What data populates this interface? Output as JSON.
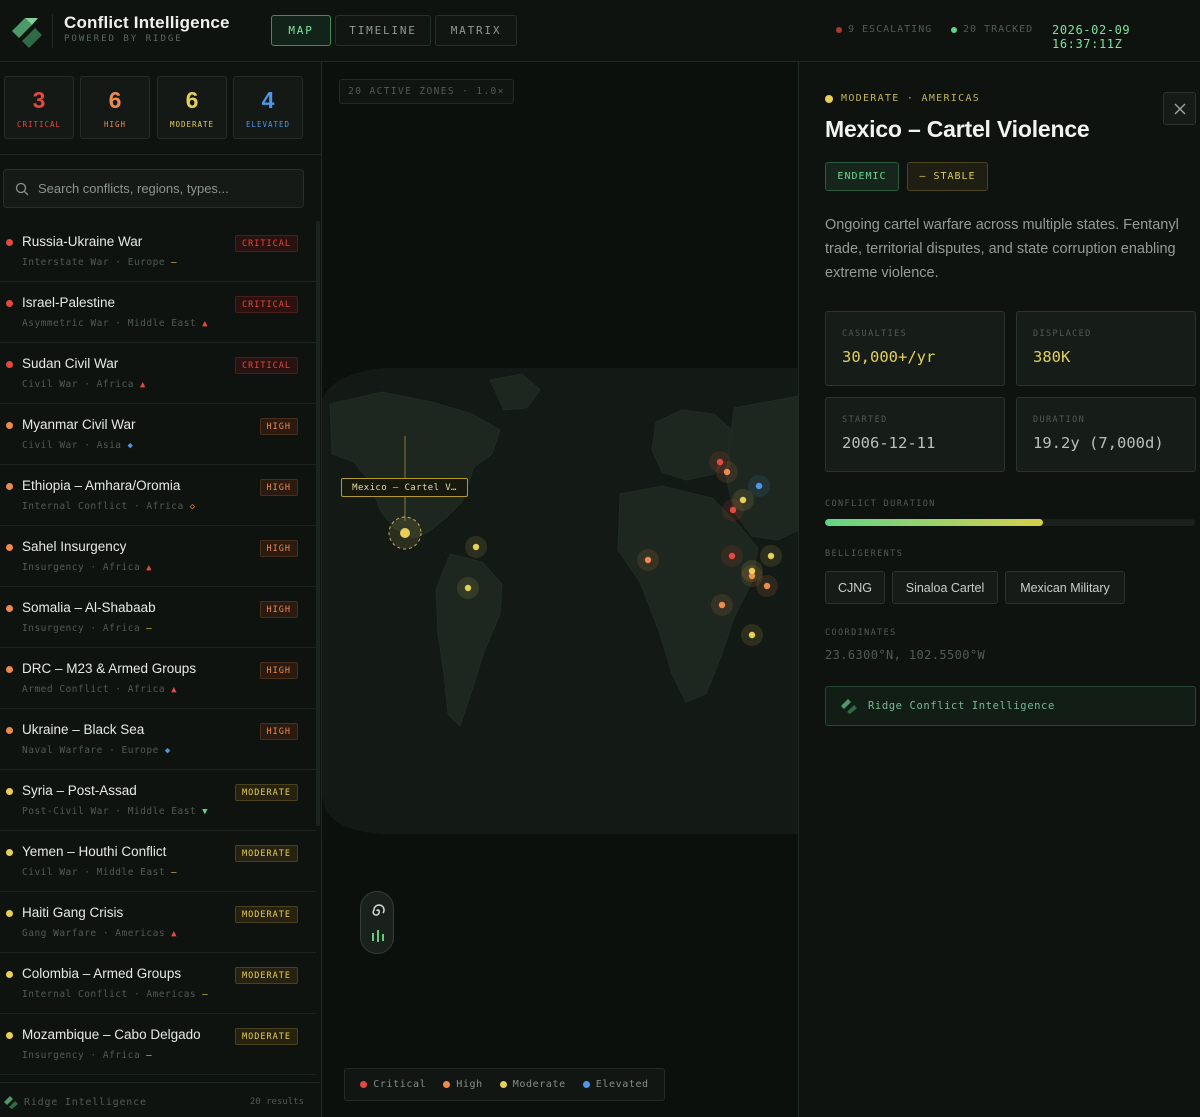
{
  "header": {
    "title": "Conflict Intelligence",
    "subtitle": "POWERED BY RIDGE",
    "tabs": [
      {
        "label": "MAP",
        "active": true
      },
      {
        "label": "TIMELINE",
        "active": false
      },
      {
        "label": "MATRIX",
        "active": false
      }
    ],
    "escalating": "9 ESCALATING",
    "tracked": "20 TRACKED",
    "clock": "2026-02-09 16:37:11Z"
  },
  "stats": [
    {
      "value": "3",
      "label": "CRITICAL",
      "color": "#e5483d"
    },
    {
      "value": "6",
      "label": "HIGH",
      "color": "#ef8a4f"
    },
    {
      "value": "6",
      "label": "MODERATE",
      "color": "#e8cf58"
    },
    {
      "value": "4",
      "label": "ELEVATED",
      "color": "#4f97e6"
    }
  ],
  "search": {
    "placeholder": "Search conflicts, regions, types..."
  },
  "conflicts": [
    {
      "name": "Russia-Ukraine War",
      "meta": "Interstate War · Europe",
      "trend": "—",
      "badge": "CRITICAL",
      "level": "critical"
    },
    {
      "name": "Israel-Palestine",
      "meta": "Asymmetric War · Middle East",
      "trend": "▲",
      "badge": "CRITICAL",
      "level": "critical"
    },
    {
      "name": "Sudan Civil War",
      "meta": "Civil War · Africa",
      "trend": "▲",
      "badge": "CRITICAL",
      "level": "critical"
    },
    {
      "name": "Myanmar Civil War",
      "meta": "Civil War · Asia",
      "trend": "◆",
      "badge": "HIGH",
      "level": "high"
    },
    {
      "name": "Ethiopia – Amhara/Oromia",
      "meta": "Internal Conflict · Africa",
      "trend": "◇",
      "badge": "HIGH",
      "level": "high"
    },
    {
      "name": "Sahel Insurgency",
      "meta": "Insurgency · Africa",
      "trend": "▲",
      "badge": "HIGH",
      "level": "high"
    },
    {
      "name": "Somalia – Al-Shabaab",
      "meta": "Insurgency · Africa",
      "trend": "—",
      "badge": "HIGH",
      "level": "high"
    },
    {
      "name": "DRC – M23 & Armed Groups",
      "meta": "Armed Conflict · Africa",
      "trend": "▲",
      "badge": "HIGH",
      "level": "high"
    },
    {
      "name": "Ukraine – Black Sea",
      "meta": "Naval Warfare · Europe",
      "trend": "◆",
      "badge": "HIGH",
      "level": "high"
    },
    {
      "name": "Syria – Post-Assad",
      "meta": "Post-Civil War · Middle East",
      "trend": "▼",
      "badge": "MODERATE",
      "level": "moderate"
    },
    {
      "name": "Yemen – Houthi Conflict",
      "meta": "Civil War · Middle East",
      "trend": "—",
      "badge": "MODERATE",
      "level": "moderate"
    },
    {
      "name": "Haiti Gang Crisis",
      "meta": "Gang Warfare · Americas",
      "trend": "▲",
      "badge": "MODERATE",
      "level": "moderate"
    },
    {
      "name": "Colombia – Armed Groups",
      "meta": "Internal Conflict · Americas",
      "trend": "—",
      "badge": "MODERATE",
      "level": "moderate"
    },
    {
      "name": "Mozambique – Cabo Delgado",
      "meta": "Insurgency · Africa",
      "trend": "—",
      "badge": "MODERATE",
      "level": "moderate"
    }
  ],
  "level_colors": {
    "critical": "#e5483d",
    "high": "#ef8a4f",
    "moderate": "#e8cf58",
    "elevated": "#4f97e6"
  },
  "trend_colors": {
    "▲": "#e5483d",
    "▼": "#5fd38a",
    "—": "#e8cf58",
    "◆": "#4f97e6",
    "◇": "#ef8a4f"
  },
  "sidebar_footer": {
    "brand": "Ridge Intelligence",
    "results": "20 results"
  },
  "map": {
    "zones": "20 ACTIVE ZONES · 1.0×",
    "tooltip": "Mexico – Cartel V…",
    "legend": [
      {
        "label": "Critical",
        "color": "#e5483d"
      },
      {
        "label": "High",
        "color": "#ef8a4f"
      },
      {
        "label": "Moderate",
        "color": "#e8cf58"
      },
      {
        "label": "Elevated",
        "color": "#4f97e6"
      }
    ]
  },
  "detail": {
    "category": "MODERATE · AMERICAS",
    "title": "Mexico – Cartel Violence",
    "tags": [
      "ENDEMIC",
      "— STABLE"
    ],
    "description": "Ongoing cartel warfare across multiple states. Fentanyl trade, territorial disputes, and state corruption enabling extreme violence.",
    "cards": [
      {
        "label": "CASUALTIES",
        "value": "30,000+/yr"
      },
      {
        "label": "DISPLACED",
        "value": "380K"
      },
      {
        "label": "STARTED",
        "value": "2006-12-11"
      },
      {
        "label": "DURATION",
        "value": "19.2y (7,000d)"
      }
    ],
    "duration_label": "CONFLICT DURATION",
    "duration_progress": 0.59,
    "belligerents_label": "BELLIGERENTS",
    "belligerents": [
      "CJNG",
      "Sinaloa Cartel",
      "Mexican Military"
    ],
    "coordinates_label": "COORDINATES",
    "coordinates": "23.6300°N, 102.5500°W",
    "brand": "Ridge Conflict Intelligence"
  }
}
